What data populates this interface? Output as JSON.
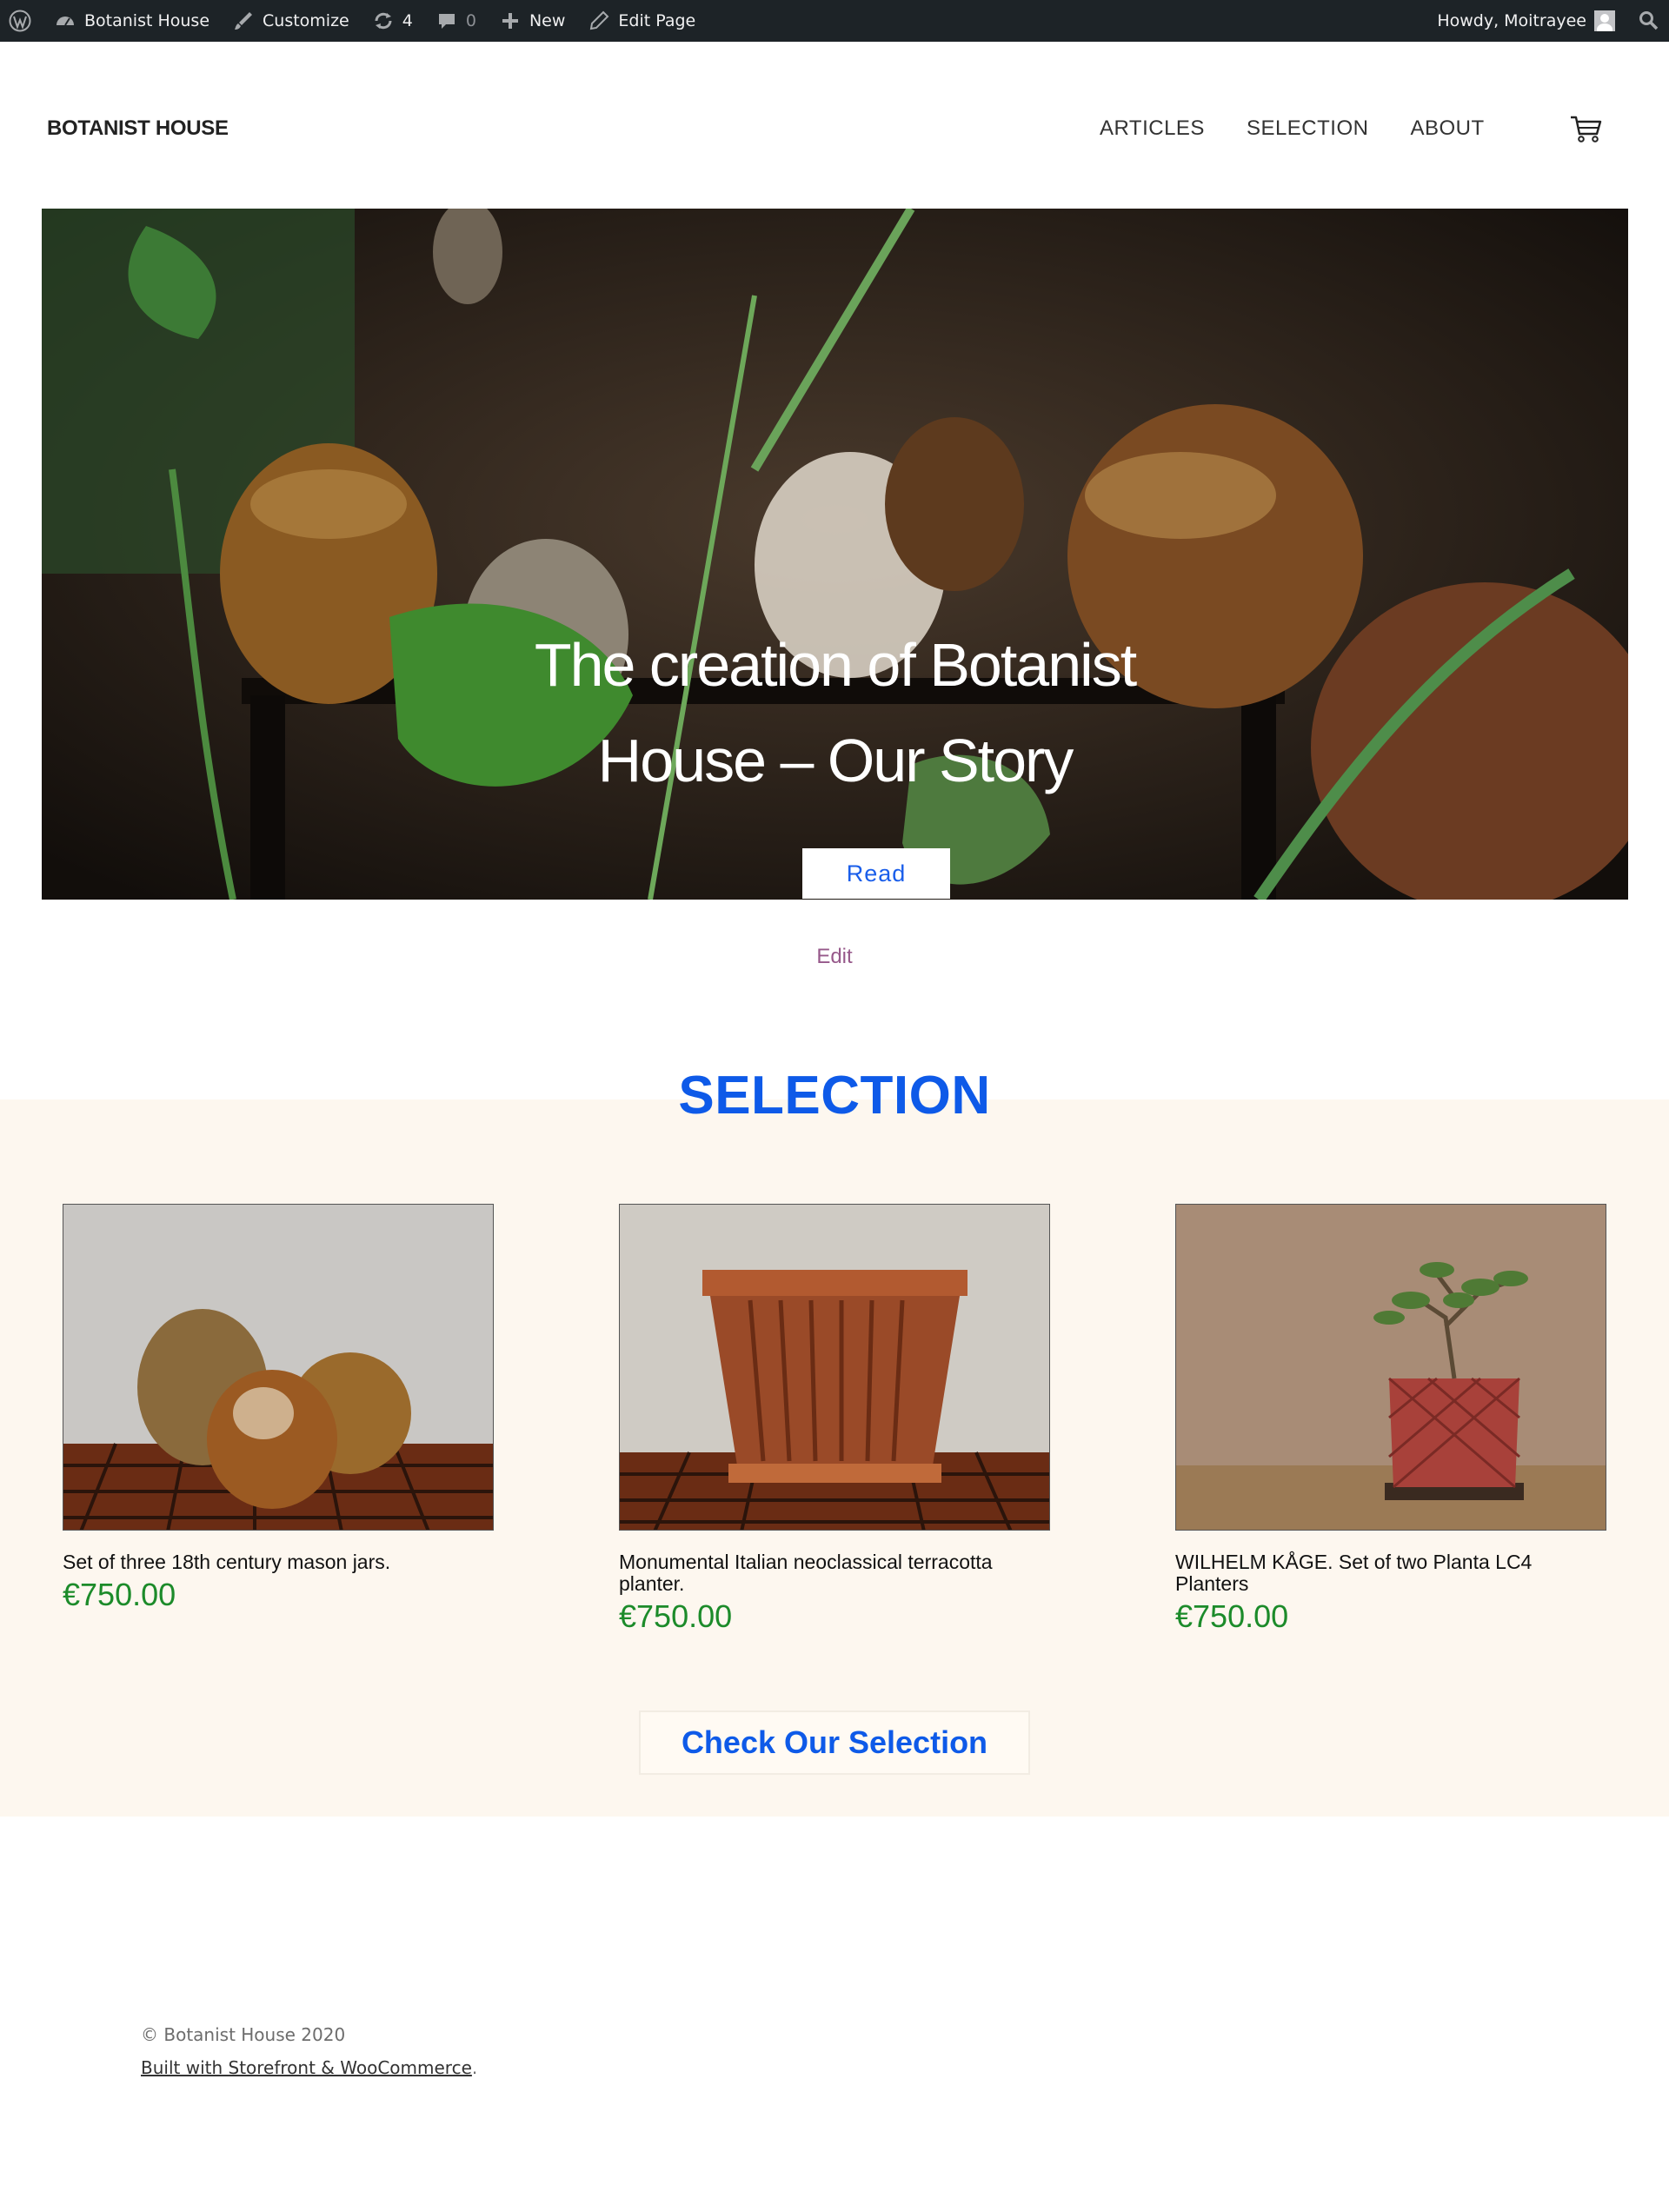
{
  "admin_bar": {
    "site_name": "Botanist House",
    "customize": "Customize",
    "updates_count": "4",
    "comments_count": "0",
    "new_label": "New",
    "edit_page": "Edit Page",
    "howdy": "Howdy, Moitrayee"
  },
  "header": {
    "brand": "BOTANIST HOUSE",
    "nav": [
      "ARTICLES",
      "SELECTION",
      "ABOUT"
    ]
  },
  "hero": {
    "title": "The creation of Botanist House – Our Story",
    "button": "Read"
  },
  "edit_link": "Edit",
  "selection": {
    "title": "SELECTION",
    "products": [
      {
        "name": "Set of three 18th century mason jars.",
        "price": "€750.00"
      },
      {
        "name": "Monumental Italian neoclassical terracotta planter.",
        "price": "€750.00"
      },
      {
        "name": "WILHELM KÅGE. Set of two Planta LC4 Planters",
        "price": "€750.00"
      }
    ],
    "cta": "Check Our Selection"
  },
  "footer": {
    "copyright": "© Botanist House 2020",
    "built_with": "Built with Storefront & WooCommerce",
    "period": "."
  },
  "colors": {
    "admin_bg": "#1d2327",
    "accent_blue": "#0e5ae8",
    "price_green": "#1c8b2a",
    "edit_purple": "#96588a",
    "selection_bg": "#fdf7ef"
  }
}
